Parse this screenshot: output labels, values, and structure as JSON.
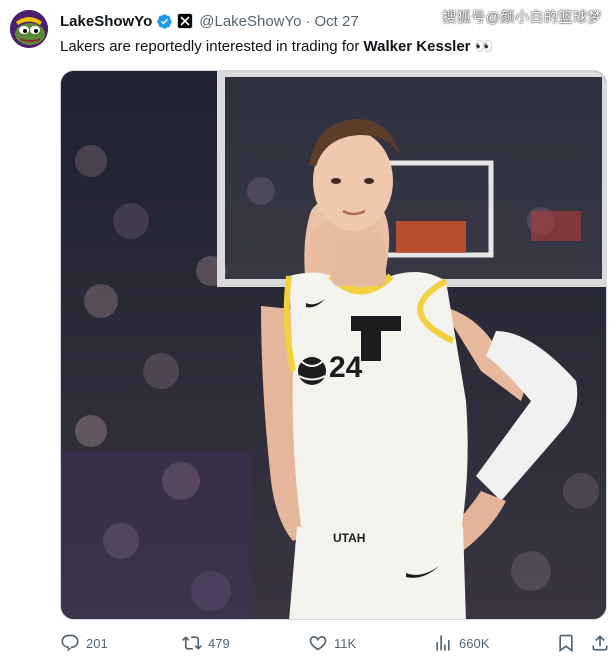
{
  "tweet": {
    "display_name": "LakeShowYo",
    "handle": "@LakeShowYo",
    "separator": "·",
    "date": "Oct 27",
    "text_prefix": "Lakers are reportedly interested in trading for ",
    "text_bold": "Walker Kessler",
    "text_suffix": " 👀",
    "icons": [
      "avatar",
      "verified-badge-icon",
      "affiliate-badge-icon"
    ]
  },
  "watermark": "搜狐号@颜小白的篮球梦",
  "media": {
    "jersey_team": "UTAH",
    "jersey_number": "24",
    "colors": {
      "jersey": "#f4f3ee",
      "trim": "#f2d13d",
      "court_bg": "#2b2f3a"
    }
  },
  "actions": {
    "replies": "201",
    "reposts": "479",
    "likes": "11K",
    "views": "660K",
    "icons": [
      "reply-icon",
      "repost-icon",
      "like-icon",
      "views-icon",
      "bookmark-icon",
      "share-icon"
    ]
  },
  "colors": {
    "text": "#0f1419",
    "muted": "#536471",
    "verified": "#1d9bf0",
    "border": "#cfd9de"
  }
}
